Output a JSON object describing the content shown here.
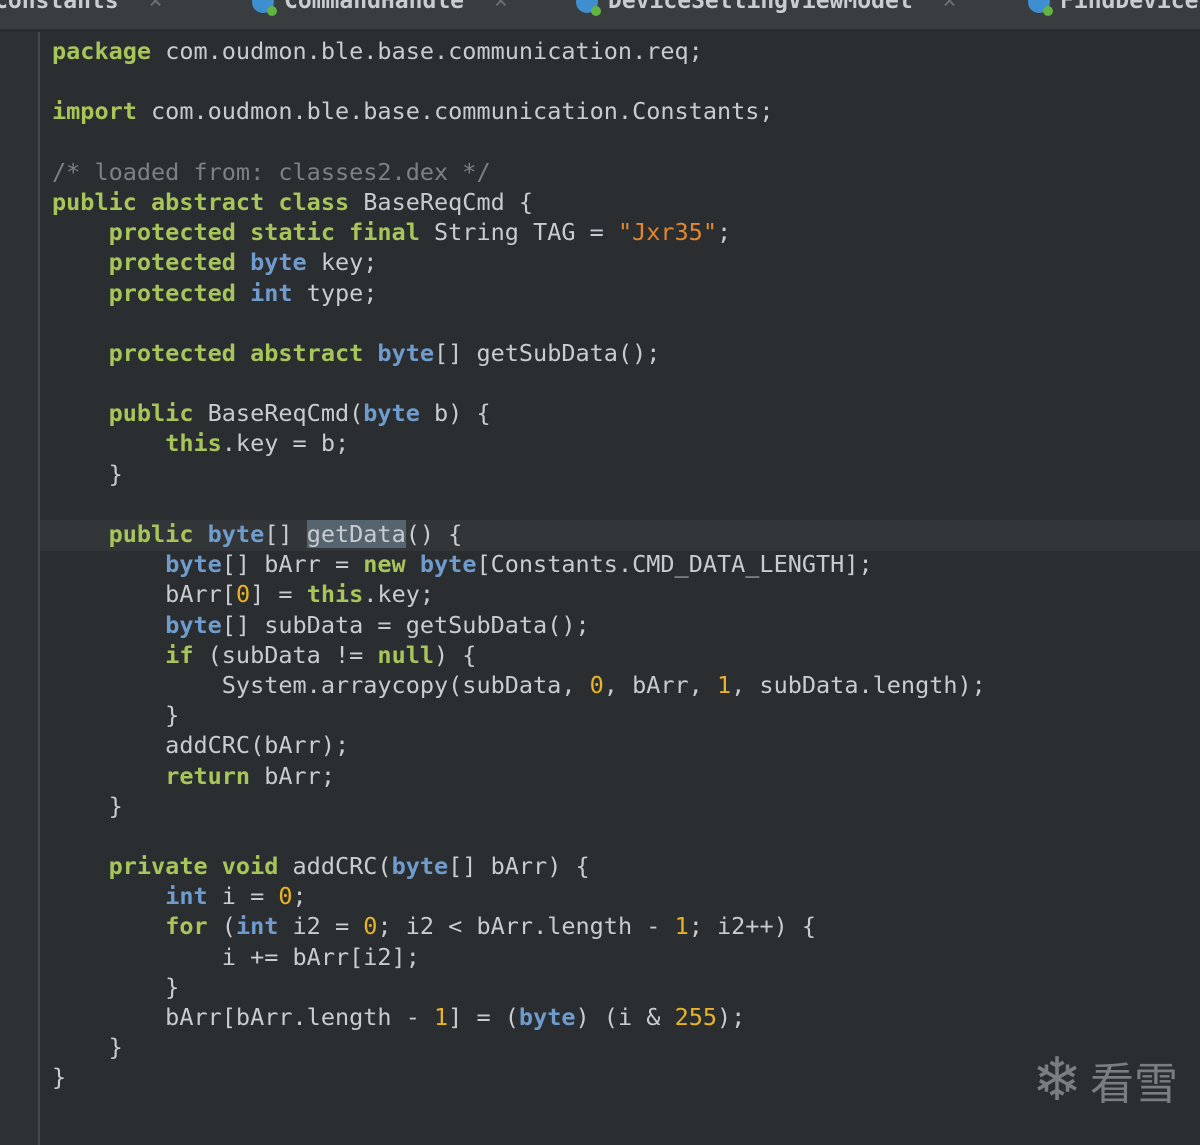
{
  "tabs": [
    {
      "label": "Constants",
      "icon": "class-icon"
    },
    {
      "label": "CommandHandle",
      "icon": "class-icon"
    },
    {
      "label": "DeviceSettingViewModel",
      "icon": "class-icon"
    },
    {
      "label": "FindDevice",
      "icon": "class-icon"
    }
  ],
  "watermark": {
    "icon": "snowflake-icon",
    "text": "看雪"
  },
  "colors": {
    "keyword": "#a8c55a",
    "type": "#6f9ccc",
    "number": "#e8b425",
    "string": "#e2872e",
    "comment": "#7d8084",
    "background": "#2b2e31"
  },
  "code": {
    "current_line": 17,
    "lines": [
      [
        [
          "package",
          "kw"
        ],
        [
          " com.oudmon.ble.base.communication.req;",
          ""
        ]
      ],
      [],
      [
        [
          "import",
          "kw"
        ],
        [
          " com.oudmon.ble.base.communication.Constants;",
          ""
        ]
      ],
      [],
      [
        [
          "/* loaded from: classes2.dex */",
          "cm"
        ]
      ],
      [
        [
          "public abstract class",
          "kw"
        ],
        [
          " BaseReqCmd {",
          ""
        ]
      ],
      [
        [
          "    ",
          ""
        ],
        [
          "protected static final",
          "kw"
        ],
        [
          " String TAG = ",
          ""
        ],
        [
          "\"Jxr35\"",
          "str"
        ],
        [
          ";",
          ""
        ]
      ],
      [
        [
          "    ",
          ""
        ],
        [
          "protected",
          "kw"
        ],
        [
          " ",
          ""
        ],
        [
          "byte",
          "ty"
        ],
        [
          " key;",
          ""
        ]
      ],
      [
        [
          "    ",
          ""
        ],
        [
          "protected",
          "kw"
        ],
        [
          " ",
          ""
        ],
        [
          "int",
          "ty"
        ],
        [
          " type;",
          ""
        ]
      ],
      [],
      [
        [
          "    ",
          ""
        ],
        [
          "protected abstract",
          "kw"
        ],
        [
          " ",
          ""
        ],
        [
          "byte",
          "ty"
        ],
        [
          "[] getSubData();",
          ""
        ]
      ],
      [],
      [
        [
          "    ",
          ""
        ],
        [
          "public",
          "kw"
        ],
        [
          " BaseReqCmd(",
          ""
        ],
        [
          "byte",
          "ty"
        ],
        [
          " b) {",
          ""
        ]
      ],
      [
        [
          "        ",
          ""
        ],
        [
          "this",
          "kw"
        ],
        [
          ".key = b;",
          ""
        ]
      ],
      [
        [
          "    }",
          ""
        ]
      ],
      [],
      [
        [
          "    ",
          ""
        ],
        [
          "public",
          "kw"
        ],
        [
          " ",
          ""
        ],
        [
          "byte",
          "ty"
        ],
        [
          "[] ",
          ""
        ],
        [
          "getData",
          "sel"
        ],
        [
          "() {",
          ""
        ]
      ],
      [
        [
          "        ",
          ""
        ],
        [
          "byte",
          "ty"
        ],
        [
          "[] bArr = ",
          ""
        ],
        [
          "new",
          "kw"
        ],
        [
          " ",
          ""
        ],
        [
          "byte",
          "ty"
        ],
        [
          "[Constants.CMD_DATA_LENGTH];",
          ""
        ]
      ],
      [
        [
          "        bArr[",
          ""
        ],
        [
          "0",
          "num"
        ],
        [
          "] = ",
          ""
        ],
        [
          "this",
          "kw"
        ],
        [
          ".key;",
          ""
        ]
      ],
      [
        [
          "        ",
          ""
        ],
        [
          "byte",
          "ty"
        ],
        [
          "[] subData = getSubData();",
          ""
        ]
      ],
      [
        [
          "        ",
          ""
        ],
        [
          "if",
          "kw"
        ],
        [
          " (subData != ",
          ""
        ],
        [
          "null",
          "kw"
        ],
        [
          ") {",
          ""
        ]
      ],
      [
        [
          "            System.arraycopy(subData, ",
          ""
        ],
        [
          "0",
          "num"
        ],
        [
          ", bArr, ",
          ""
        ],
        [
          "1",
          "num"
        ],
        [
          ", subData.length);",
          ""
        ]
      ],
      [
        [
          "        }",
          ""
        ]
      ],
      [
        [
          "        addCRC(bArr);",
          ""
        ]
      ],
      [
        [
          "        ",
          ""
        ],
        [
          "return",
          "kw"
        ],
        [
          " bArr;",
          ""
        ]
      ],
      [
        [
          "    }",
          ""
        ]
      ],
      [],
      [
        [
          "    ",
          ""
        ],
        [
          "private void",
          "kw"
        ],
        [
          " addCRC(",
          ""
        ],
        [
          "byte",
          "ty"
        ],
        [
          "[] bArr) {",
          ""
        ]
      ],
      [
        [
          "        ",
          ""
        ],
        [
          "int",
          "ty"
        ],
        [
          " i = ",
          ""
        ],
        [
          "0",
          "num"
        ],
        [
          ";",
          ""
        ]
      ],
      [
        [
          "        ",
          ""
        ],
        [
          "for",
          "kw"
        ],
        [
          " (",
          ""
        ],
        [
          "int",
          "ty"
        ],
        [
          " i2 = ",
          ""
        ],
        [
          "0",
          "num"
        ],
        [
          "; i2 < bArr.length - ",
          ""
        ],
        [
          "1",
          "num"
        ],
        [
          "; i2++) {",
          ""
        ]
      ],
      [
        [
          "            i += bArr[i2];",
          ""
        ]
      ],
      [
        [
          "        }",
          ""
        ]
      ],
      [
        [
          "        bArr[bArr.length - ",
          ""
        ],
        [
          "1",
          "num"
        ],
        [
          "] = (",
          ""
        ],
        [
          "byte",
          "ty"
        ],
        [
          ") (i & ",
          ""
        ],
        [
          "255",
          "num"
        ],
        [
          ");",
          ""
        ]
      ],
      [
        [
          "    }",
          ""
        ]
      ],
      [
        [
          "}",
          ""
        ]
      ]
    ]
  }
}
